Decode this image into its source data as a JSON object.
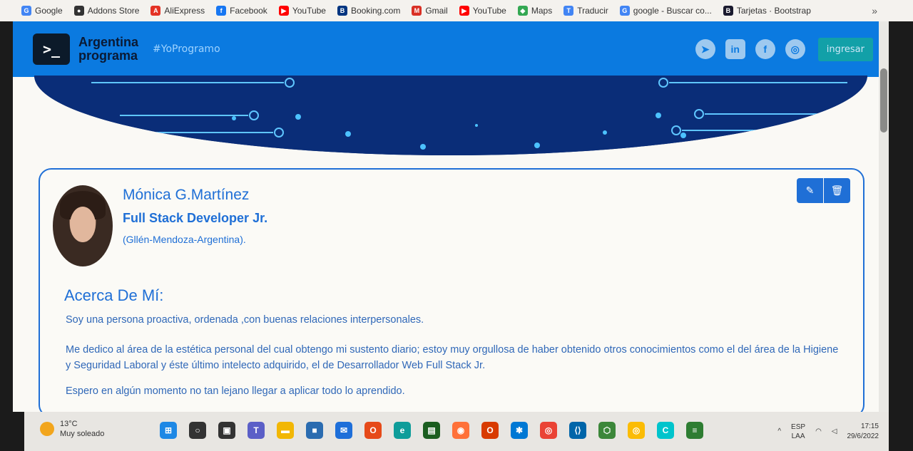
{
  "bookmarks": [
    {
      "label": "Google",
      "icon": "google-icon",
      "color": "#4285f4",
      "glyph": "G"
    },
    {
      "label": "Addons Store",
      "icon": "addons-store-icon",
      "color": "#333333",
      "glyph": "●"
    },
    {
      "label": "AliExpress",
      "icon": "aliexpress-icon",
      "color": "#e43225",
      "glyph": "A"
    },
    {
      "label": "Facebook",
      "icon": "facebook-icon",
      "color": "#1877f2",
      "glyph": "f"
    },
    {
      "label": "YouTube",
      "icon": "youtube-icon",
      "color": "#ff0000",
      "glyph": "▶"
    },
    {
      "label": "Booking.com",
      "icon": "booking-icon",
      "color": "#003580",
      "glyph": "B"
    },
    {
      "label": "Gmail",
      "icon": "gmail-icon",
      "color": "#d93025",
      "glyph": "M"
    },
    {
      "label": "YouTube",
      "icon": "youtube-icon",
      "color": "#ff0000",
      "glyph": "▶"
    },
    {
      "label": "Maps",
      "icon": "maps-icon",
      "color": "#34a853",
      "glyph": "◆"
    },
    {
      "label": "Traducir",
      "icon": "translate-icon",
      "color": "#4285f4",
      "glyph": "T"
    },
    {
      "label": "google - Buscar co...",
      "icon": "google-icon",
      "color": "#4285f4",
      "glyph": "G"
    },
    {
      "label": "Tarjetas · Bootstrap",
      "icon": "bootstrap-icon",
      "color": "#1a1a2e",
      "glyph": "B"
    }
  ],
  "bookmarks_more": "»",
  "navbar": {
    "logo_glyph": ">_",
    "brand_line1": "Argentina",
    "brand_line2": "programa",
    "hashtag": "#YoProgramo",
    "login_label": "ingresar",
    "socials": [
      {
        "icon": "telegram-icon",
        "glyph": "➤"
      },
      {
        "icon": "linkedin-icon",
        "glyph": "in"
      },
      {
        "icon": "facebook-icon",
        "glyph": "f"
      },
      {
        "icon": "instagram-icon",
        "glyph": "◎"
      }
    ]
  },
  "profile": {
    "name": "Mónica G.Martínez",
    "role": "Full Stack Developer Jr.",
    "location": "(Gllén-Mendoza-Argentina).",
    "edit_icon": "✎",
    "delete_icon": "🗑"
  },
  "about": {
    "title": "Acerca De Mí:",
    "paragraph1": "Soy una persona proactiva, ordenada ,con buenas relaciones interpersonales.",
    "paragraph2": "Me dedico al área de la estética personal del cual obtengo mi sustento diario; estoy muy orgullosa de haber obtenido otros conocimientos como el del área de la Higiene y Seguridad Laboral y éste último intelecto adquirido, el de Desarrollador Web Full Stack Jr.",
    "paragraph3": "Espero en algún momento no tan lejano llegar a aplicar todo lo aprendido."
  },
  "taskbar": {
    "weather_temp": "13°C",
    "weather_desc": "Muy soleado",
    "apps": [
      {
        "icon": "windows-start-icon",
        "color": "#1e88e5",
        "glyph": "⊞"
      },
      {
        "icon": "search-icon",
        "color": "#333333",
        "glyph": "○"
      },
      {
        "icon": "task-view-icon",
        "color": "#333333",
        "glyph": "▣"
      },
      {
        "icon": "teams-icon",
        "color": "#5b5fc7",
        "glyph": "T"
      },
      {
        "icon": "file-explorer-icon",
        "color": "#f2b705",
        "glyph": "▬"
      },
      {
        "icon": "store-icon",
        "color": "#2b6cb0",
        "glyph": "■"
      },
      {
        "icon": "mail-icon",
        "color": "#1e6fd9",
        "glyph": "✉"
      },
      {
        "icon": "office-icon",
        "color": "#e64a19",
        "glyph": "O"
      },
      {
        "icon": "edge-icon",
        "color": "#0f9d9a",
        "glyph": "e"
      },
      {
        "icon": "app-icon",
        "color": "#1b5e20",
        "glyph": "▤"
      },
      {
        "icon": "firefox-icon",
        "color": "#ff7139",
        "glyph": "◉"
      },
      {
        "icon": "office-icon",
        "color": "#d83b01",
        "glyph": "O"
      },
      {
        "icon": "app-icon",
        "color": "#0078d4",
        "glyph": "✱"
      },
      {
        "icon": "chrome-icon",
        "color": "#ea4335",
        "glyph": "◎"
      },
      {
        "icon": "vscode-icon",
        "color": "#0065a9",
        "glyph": "⟨⟩"
      },
      {
        "icon": "nodejs-icon",
        "color": "#3c873a",
        "glyph": "⬡"
      },
      {
        "icon": "chrome-icon",
        "color": "#fbbc05",
        "glyph": "◎"
      },
      {
        "icon": "canva-icon",
        "color": "#00c4cc",
        "glyph": "C"
      },
      {
        "icon": "notepad-icon",
        "color": "#2e7d32",
        "glyph": "≡"
      }
    ],
    "lang_line1": "ESP",
    "lang_line2": "LAA",
    "time": "17:15",
    "date": "29/6/2022"
  },
  "colors": {
    "accent": "#1f6fd6",
    "navbar": "#0b7ae0",
    "login_button": "#12a0a8"
  }
}
